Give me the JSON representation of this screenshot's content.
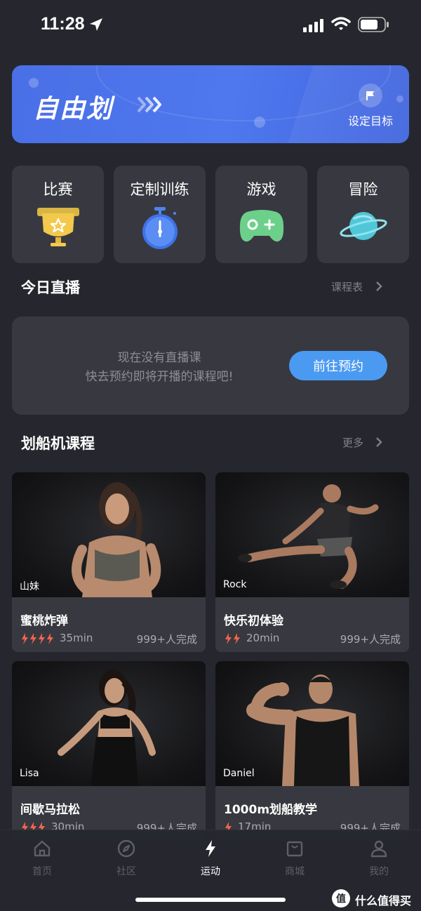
{
  "status_bar": {
    "time": "11:28"
  },
  "banner": {
    "title": "自由划",
    "goal_label": "设定目标"
  },
  "categories": [
    {
      "label": "比赛",
      "icon": "trophy-icon"
    },
    {
      "label": "定制训练",
      "icon": "stopwatch-icon"
    },
    {
      "label": "游戏",
      "icon": "gamepad-icon"
    },
    {
      "label": "冒险",
      "icon": "planet-icon"
    }
  ],
  "live": {
    "title": "今日直播",
    "schedule_link": "课程表",
    "empty_line1": "现在没有直播课",
    "empty_line2": "快去预约即将开播的课程吧!",
    "book_button": "前往预约"
  },
  "courses_section": {
    "title": "划船机课程",
    "more_link": "更多"
  },
  "courses": [
    {
      "coach": "山妹",
      "title": "蜜桃炸弹",
      "intensity": 4,
      "duration": "35min",
      "completed": "999+人完成"
    },
    {
      "coach": "Rock",
      "title": "快乐初体验",
      "intensity": 2,
      "duration": "20min",
      "completed": "999+人完成"
    },
    {
      "coach": "Lisa",
      "title": "间歇马拉松",
      "intensity": 3,
      "duration": "30min",
      "completed": "999+人完成"
    },
    {
      "coach": "Daniel",
      "title": "1000m划船教学",
      "intensity": 1,
      "duration": "17min",
      "completed": "999+人完成"
    }
  ],
  "tab_bar": {
    "items": [
      {
        "label": "首页",
        "icon": "home-icon"
      },
      {
        "label": "社区",
        "icon": "compass-icon"
      },
      {
        "label": "运动",
        "icon": "lightning-icon",
        "active": true
      },
      {
        "label": "商城",
        "icon": "shopping-bag-icon"
      },
      {
        "label": "我的",
        "icon": "profile-icon"
      }
    ]
  },
  "watermark": {
    "text": "什么值得买",
    "logo_char": "值"
  },
  "colors": {
    "background": "#26272e",
    "card": "#383940",
    "accent_blue": "#4b9af2",
    "banner_blue": "#4a6fe6",
    "bolt_red": "#f0644e"
  }
}
